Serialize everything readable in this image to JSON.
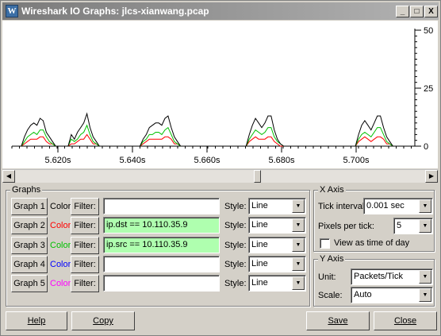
{
  "window": {
    "title": "Wireshark IO Graphs: jlcs-xianwang.pcap",
    "icon_letter": "W",
    "controls": {
      "minimize": "_",
      "maximize": "□",
      "close": "X"
    }
  },
  "y_ticks": [
    "50",
    "25",
    "0"
  ],
  "x_ticks": [
    "5.620s",
    "5.640s",
    "5.660s",
    "5.680s",
    "5.700s"
  ],
  "chart_data": {
    "type": "line",
    "x_ticks": [
      "5.620s",
      "5.640s",
      "5.660s",
      "5.680s",
      "5.700s"
    ],
    "y_ticks": [
      0,
      25,
      50
    ],
    "ylim": [
      0,
      50
    ],
    "series": [
      {
        "name": "Graph 1",
        "color": "#000000",
        "values": [
          0,
          0,
          0,
          4,
          7,
          9,
          10,
          9,
          12,
          11,
          6,
          4,
          2,
          0,
          0,
          0,
          0,
          0,
          5,
          3,
          6,
          8,
          10,
          14,
          8,
          4,
          2,
          0,
          0,
          0,
          0,
          0,
          0,
          0,
          0,
          0,
          0,
          0,
          0,
          0,
          0,
          3,
          5,
          8,
          9,
          10,
          10,
          9,
          12,
          13,
          8,
          4,
          2,
          0,
          0,
          0,
          0,
          0,
          0,
          0,
          0,
          0,
          0,
          0,
          0,
          0,
          0,
          0,
          0,
          0,
          0,
          0,
          0,
          0,
          0,
          5,
          9,
          12,
          10,
          8,
          10,
          13,
          13,
          7,
          3,
          1,
          0,
          0,
          0,
          0,
          0,
          0,
          0,
          0,
          0,
          0,
          0,
          0,
          0,
          0,
          0,
          0,
          0,
          0,
          0,
          0,
          0,
          0,
          0,
          0,
          5,
          9,
          11,
          9,
          7,
          10,
          13,
          13,
          8,
          4,
          2,
          0,
          0,
          0,
          0,
          0,
          0,
          0
        ]
      },
      {
        "name": "Graph 2",
        "color": "#ff0000",
        "values": [
          0,
          0,
          0,
          1,
          2,
          3,
          3,
          3,
          4,
          4,
          2,
          1,
          1,
          0,
          0,
          0,
          0,
          0,
          1,
          1,
          2,
          3,
          3,
          5,
          3,
          1,
          1,
          0,
          0,
          0,
          0,
          0,
          0,
          0,
          0,
          0,
          0,
          0,
          0,
          0,
          0,
          1,
          2,
          3,
          3,
          3,
          3,
          3,
          4,
          4,
          3,
          1,
          1,
          0,
          0,
          0,
          0,
          0,
          0,
          0,
          0,
          0,
          0,
          0,
          0,
          0,
          0,
          0,
          0,
          0,
          0,
          0,
          0,
          0,
          0,
          2,
          3,
          4,
          3,
          3,
          3,
          4,
          4,
          2,
          1,
          0,
          0,
          0,
          0,
          0,
          0,
          0,
          0,
          0,
          0,
          0,
          0,
          0,
          0,
          0,
          0,
          0,
          0,
          0,
          0,
          0,
          0,
          0,
          0,
          0,
          2,
          3,
          4,
          3,
          2,
          3,
          4,
          4,
          3,
          1,
          1,
          0,
          0,
          0,
          0,
          0,
          0,
          0
        ]
      },
      {
        "name": "Graph 3",
        "color": "#00c000",
        "values": [
          0,
          0,
          0,
          2,
          4,
          5,
          6,
          5,
          7,
          7,
          4,
          2,
          1,
          0,
          0,
          0,
          0,
          0,
          3,
          2,
          3,
          5,
          6,
          9,
          5,
          2,
          1,
          0,
          0,
          0,
          0,
          0,
          0,
          0,
          0,
          0,
          0,
          0,
          0,
          0,
          0,
          2,
          3,
          5,
          5,
          6,
          6,
          5,
          7,
          8,
          5,
          2,
          1,
          0,
          0,
          0,
          0,
          0,
          0,
          0,
          0,
          0,
          0,
          0,
          0,
          0,
          0,
          0,
          0,
          0,
          0,
          0,
          0,
          0,
          0,
          3,
          5,
          7,
          6,
          5,
          6,
          8,
          8,
          4,
          2,
          1,
          0,
          0,
          0,
          0,
          0,
          0,
          0,
          0,
          0,
          0,
          0,
          0,
          0,
          0,
          0,
          0,
          0,
          0,
          0,
          0,
          0,
          0,
          0,
          0,
          3,
          5,
          6,
          5,
          4,
          6,
          8,
          8,
          5,
          2,
          1,
          0,
          0,
          0,
          0,
          0,
          0,
          0
        ]
      }
    ]
  },
  "graphs_group": {
    "label": "Graphs",
    "color_label": "Color",
    "filter_label": "Filter:",
    "style_label": "Style:",
    "rows": [
      {
        "button": "Graph 1",
        "color": "#000000",
        "filter": "",
        "style": "Line",
        "active": false
      },
      {
        "button": "Graph 2",
        "color": "#ff0000",
        "filter": "ip.dst == 10.110.35.9",
        "style": "Line",
        "active": true
      },
      {
        "button": "Graph 3",
        "color": "#00c000",
        "filter": "ip.src == 10.110.35.9",
        "style": "Line",
        "active": true
      },
      {
        "button": "Graph 4",
        "color": "#0000ff",
        "filter": "",
        "style": "Line",
        "active": false
      },
      {
        "button": "Graph 5",
        "color": "#ff00ff",
        "filter": "",
        "style": "Line",
        "active": false
      }
    ]
  },
  "x_axis": {
    "label": "X Axis",
    "tick_interval_label": "Tick interval:",
    "tick_interval_value": "0.001 sec",
    "pixels_per_tick_label": "Pixels per tick:",
    "pixels_per_tick_value": "5",
    "time_of_day_label": "View as time of day",
    "time_of_day_checked": false
  },
  "y_axis": {
    "label": "Y Axis",
    "unit_label": "Unit:",
    "unit_value": "Packets/Tick",
    "scale_label": "Scale:",
    "scale_value": "Auto"
  },
  "footer": {
    "help": "Help",
    "copy": "Copy",
    "save": "Save",
    "close": "Close"
  }
}
